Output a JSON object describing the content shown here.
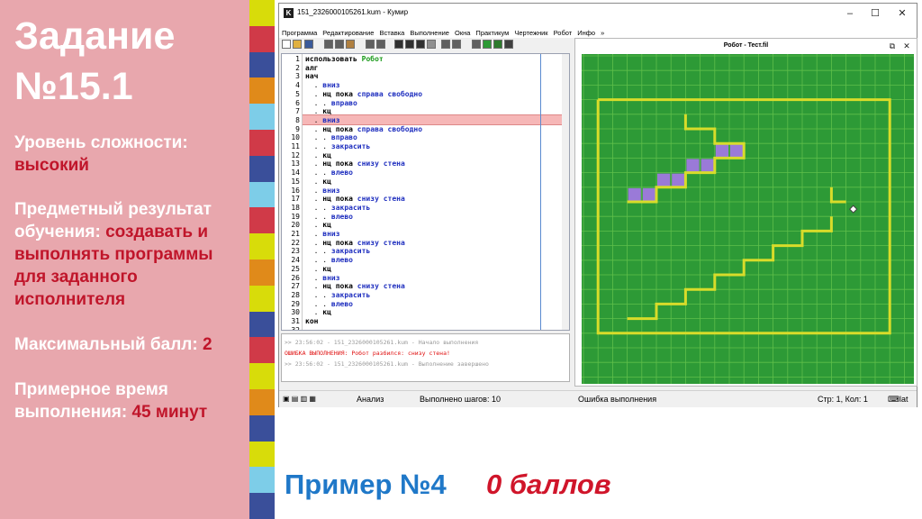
{
  "slide": {
    "title_line1": "Задание",
    "title_line2": "№15.1",
    "difficulty_label": "Уровень сложности:",
    "difficulty_value": "высокий",
    "result_label_1": "Предметный результат",
    "result_label_2": "обучения:",
    "result_value_1": "создавать и",
    "result_value_2": "выполнять программы",
    "result_value_3": "для заданного",
    "result_value_4": "исполнителя",
    "max_score_label": "Максимальный балл:",
    "max_score_value": "2",
    "time_label_1": "Примерное время",
    "time_label_2": "выполнения:",
    "time_value": "45 минут",
    "example_label": "Пример №4",
    "score_label": "0 баллов",
    "accent_color": "#c0152a",
    "stripe_colors": [
      "#d8dc0a",
      "#d03a48",
      "#3a4f9a",
      "#e08a1a",
      "#7dcde8",
      "#d03a48",
      "#3a4f9a",
      "#7dcde8",
      "#d03a48",
      "#d8dc0a",
      "#e08a1a",
      "#d8dc0a",
      "#3a4f9a",
      "#d03a48",
      "#d8dc0a",
      "#e08a1a",
      "#3a4f9a",
      "#d8dc0a",
      "#7dcde8",
      "#3a4f9a"
    ]
  },
  "window": {
    "title": "151_2326000105261.kum - Кумир",
    "app_icon_letter": "K",
    "menu": [
      "Программа",
      "Редактирование",
      "Вставка",
      "Выполнение",
      "Окна",
      "Практикум",
      "Чертежник",
      "Робот",
      "Инфо",
      "»"
    ],
    "robot_panel_title": "Робот - Тест.fil",
    "code_lines": [
      {
        "n": "1",
        "parts": [
          [
            "kw",
            "использовать "
          ],
          [
            "gr",
            "Робот"
          ]
        ]
      },
      {
        "n": "2",
        "parts": [
          [
            "kw",
            "алг"
          ]
        ]
      },
      {
        "n": "3",
        "parts": [
          [
            "kw",
            "нач"
          ]
        ]
      },
      {
        "n": "4",
        "parts": [
          [
            "",
            "  . "
          ],
          [
            "bl",
            "вниз"
          ]
        ]
      },
      {
        "n": "5",
        "parts": [
          [
            "",
            "  . "
          ],
          [
            "kw",
            "нц пока "
          ],
          [
            "bl",
            "справа свободно"
          ]
        ]
      },
      {
        "n": "6",
        "parts": [
          [
            "",
            "  . . "
          ],
          [
            "bl",
            "вправо"
          ]
        ]
      },
      {
        "n": "7",
        "parts": [
          [
            "",
            "  . "
          ],
          [
            "kw",
            "кц"
          ]
        ]
      },
      {
        "n": "8",
        "parts": [
          [
            "",
            "  . "
          ],
          [
            "bl",
            "вниз"
          ]
        ]
      },
      {
        "n": "9",
        "parts": [
          [
            "",
            "  . "
          ],
          [
            "kw",
            "нц пока "
          ],
          [
            "bl",
            "справа свободно"
          ]
        ]
      },
      {
        "n": "10",
        "parts": [
          [
            "",
            "  . . "
          ],
          [
            "bl",
            "вправо"
          ]
        ]
      },
      {
        "n": "11",
        "parts": [
          [
            "",
            "  . . "
          ],
          [
            "bl",
            "закрасить"
          ]
        ]
      },
      {
        "n": "12",
        "parts": [
          [
            "",
            "  . "
          ],
          [
            "kw",
            "кц"
          ]
        ]
      },
      {
        "n": "13",
        "parts": [
          [
            "",
            "  . "
          ],
          [
            "kw",
            "нц пока "
          ],
          [
            "bl",
            "снизу стена"
          ]
        ]
      },
      {
        "n": "14",
        "parts": [
          [
            "",
            "  . . "
          ],
          [
            "bl",
            "влево"
          ]
        ]
      },
      {
        "n": "15",
        "parts": [
          [
            "",
            "  . "
          ],
          [
            "kw",
            "кц"
          ]
        ]
      },
      {
        "n": "16",
        "parts": [
          [
            "",
            "  . "
          ],
          [
            "bl",
            "вниз"
          ]
        ]
      },
      {
        "n": "17",
        "parts": [
          [
            "",
            "  . "
          ],
          [
            "kw",
            "нц пока "
          ],
          [
            "bl",
            "снизу стена"
          ]
        ]
      },
      {
        "n": "18",
        "parts": [
          [
            "",
            "  . . "
          ],
          [
            "bl",
            "закрасить"
          ]
        ]
      },
      {
        "n": "19",
        "parts": [
          [
            "",
            "  . . "
          ],
          [
            "bl",
            "влево"
          ]
        ]
      },
      {
        "n": "20",
        "parts": [
          [
            "",
            "  . "
          ],
          [
            "kw",
            "кц"
          ]
        ]
      },
      {
        "n": "21",
        "parts": [
          [
            "",
            "  . "
          ],
          [
            "bl",
            "вниз"
          ]
        ]
      },
      {
        "n": "22",
        "parts": [
          [
            "",
            "  . "
          ],
          [
            "kw",
            "нц пока "
          ],
          [
            "bl",
            "снизу стена"
          ]
        ]
      },
      {
        "n": "23",
        "parts": [
          [
            "",
            "  . . "
          ],
          [
            "bl",
            "закрасить"
          ]
        ]
      },
      {
        "n": "24",
        "parts": [
          [
            "",
            "  . . "
          ],
          [
            "bl",
            "влево"
          ]
        ]
      },
      {
        "n": "25",
        "parts": [
          [
            "",
            "  . "
          ],
          [
            "kw",
            "кц"
          ]
        ]
      },
      {
        "n": "26",
        "parts": [
          [
            "",
            "  . "
          ],
          [
            "bl",
            "вниз"
          ]
        ]
      },
      {
        "n": "27",
        "parts": [
          [
            "",
            "  . "
          ],
          [
            "kw",
            "нц пока "
          ],
          [
            "bl",
            "снизу стена"
          ]
        ]
      },
      {
        "n": "28",
        "parts": [
          [
            "",
            "  . . "
          ],
          [
            "bl",
            "закрасить"
          ]
        ]
      },
      {
        "n": "29",
        "parts": [
          [
            "",
            "  . . "
          ],
          [
            "bl",
            "влево"
          ]
        ]
      },
      {
        "n": "30",
        "parts": [
          [
            "",
            "  . "
          ],
          [
            "kw",
            "кц"
          ]
        ]
      },
      {
        "n": "31",
        "parts": [
          [
            "kw",
            "кон"
          ]
        ]
      },
      {
        "n": "32",
        "parts": []
      }
    ],
    "console": [
      {
        "text": ">> 23:56:02 - 151_2326000105261.kum - Начало выполнения",
        "color": "#9a9a9a"
      },
      {
        "text": "ОШИБКА ВЫПОЛНЕНИЯ: Робот разбился: снизу стена!",
        "color": "#e01010"
      },
      {
        "text": ">> 23:56:02 - 151_2326000105261.kum - Выполнение завершено",
        "color": "#9a9a9a"
      }
    ],
    "status": {
      "analysis": "Анализ",
      "steps": "Выполнено шагов: 10",
      "error": "Ошибка выполнения",
      "position": "Стр: 1, Кол: 1",
      "lang": "lat"
    },
    "field_colors": {
      "bg": "#2d9a36",
      "grid": "#5fbf4a",
      "wall": "#d8dc2a",
      "painted": "#9a7ad8"
    }
  }
}
